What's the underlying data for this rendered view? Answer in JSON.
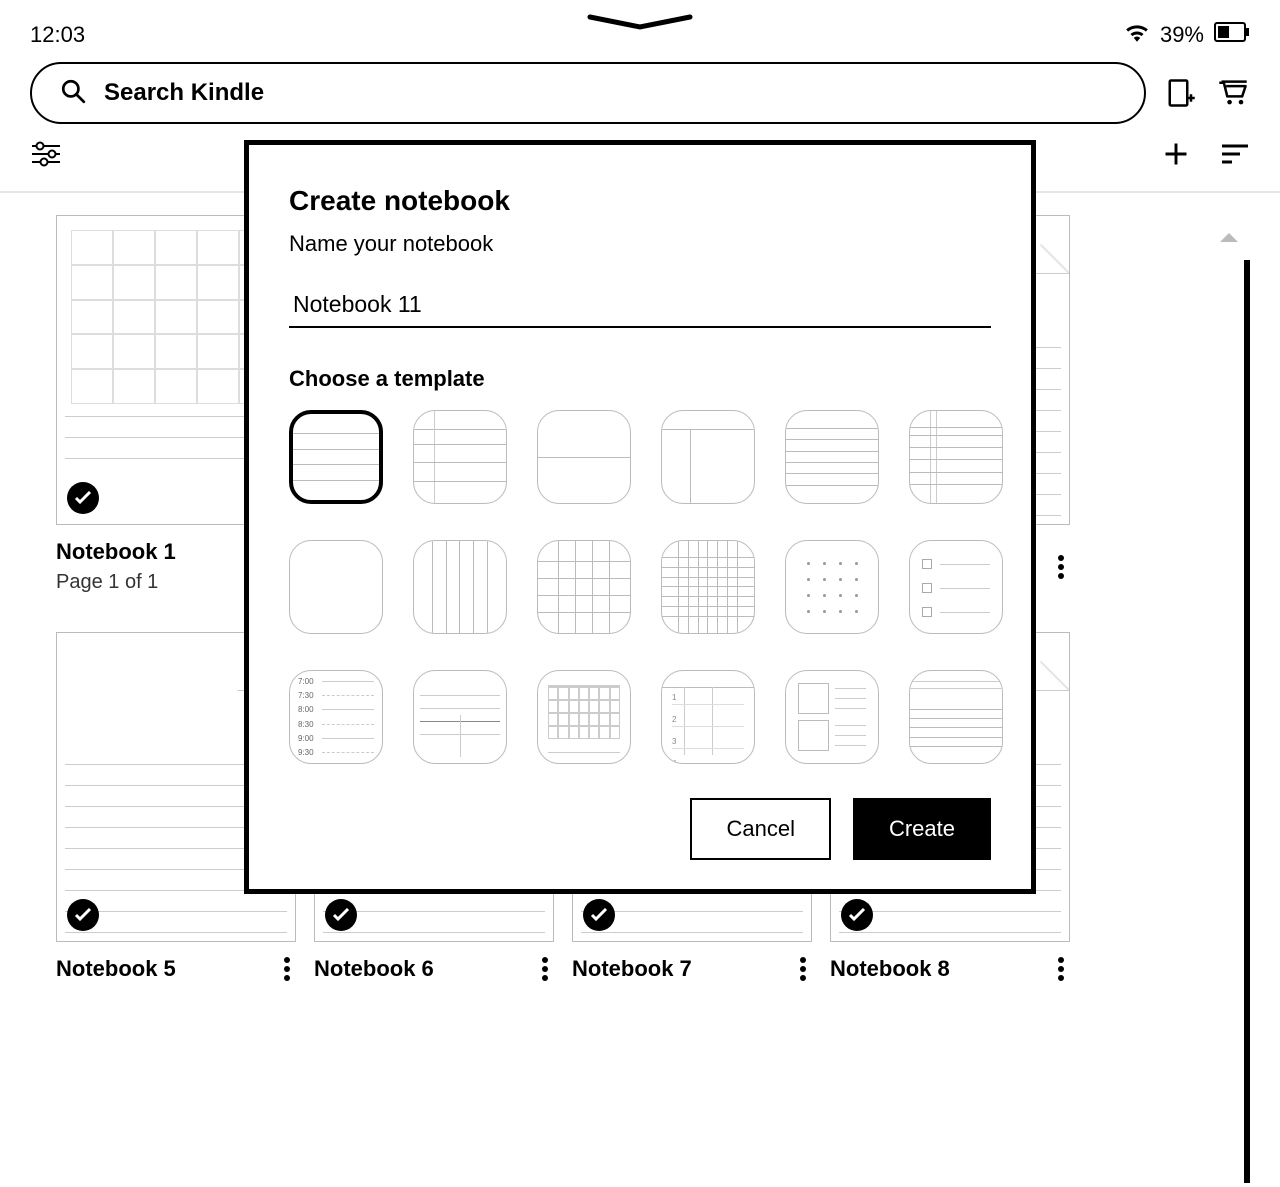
{
  "status": {
    "time": "12:03",
    "battery_pct": "39%"
  },
  "header": {
    "search_placeholder": "Search Kindle"
  },
  "modal": {
    "title": "Create notebook",
    "subtitle": "Name your notebook",
    "name_value": "Notebook 11",
    "template_title": "Choose a template",
    "templates": [
      {
        "id": "lined-wide",
        "selected": true
      },
      {
        "id": "lined-margin-top"
      },
      {
        "id": "half-split"
      },
      {
        "id": "cornell"
      },
      {
        "id": "lined-narrow"
      },
      {
        "id": "lined-margin-narrow"
      },
      {
        "id": "blank"
      },
      {
        "id": "columns"
      },
      {
        "id": "grid-large"
      },
      {
        "id": "grid-small"
      },
      {
        "id": "dot-grid"
      },
      {
        "id": "checklist"
      },
      {
        "id": "schedule"
      },
      {
        "id": "table-split"
      },
      {
        "id": "calendar"
      },
      {
        "id": "numbered-list"
      },
      {
        "id": "storyboard"
      },
      {
        "id": "top-lines"
      }
    ],
    "schedule_times": [
      "7:00",
      "7:30",
      "8:00",
      "8:30",
      "9:00",
      "9:30"
    ],
    "cancel_label": "Cancel",
    "create_label": "Create"
  },
  "library": {
    "row1": [
      {
        "title": "Notebook 1",
        "subtitle": "Page 1 of 1",
        "checked": true,
        "more": false
      },
      {
        "title": "",
        "subtitle": "",
        "checked": false,
        "more": false
      },
      {
        "title": "",
        "subtitle": "",
        "checked": false,
        "more": false
      },
      {
        "title": "",
        "subtitle": "",
        "checked": false,
        "more": true
      }
    ],
    "row2": [
      {
        "title": "Notebook 5",
        "checked": true
      },
      {
        "title": "Notebook 6",
        "checked": true
      },
      {
        "title": "Notebook 7",
        "checked": true
      },
      {
        "title": "Notebook 8",
        "checked": true
      }
    ]
  }
}
